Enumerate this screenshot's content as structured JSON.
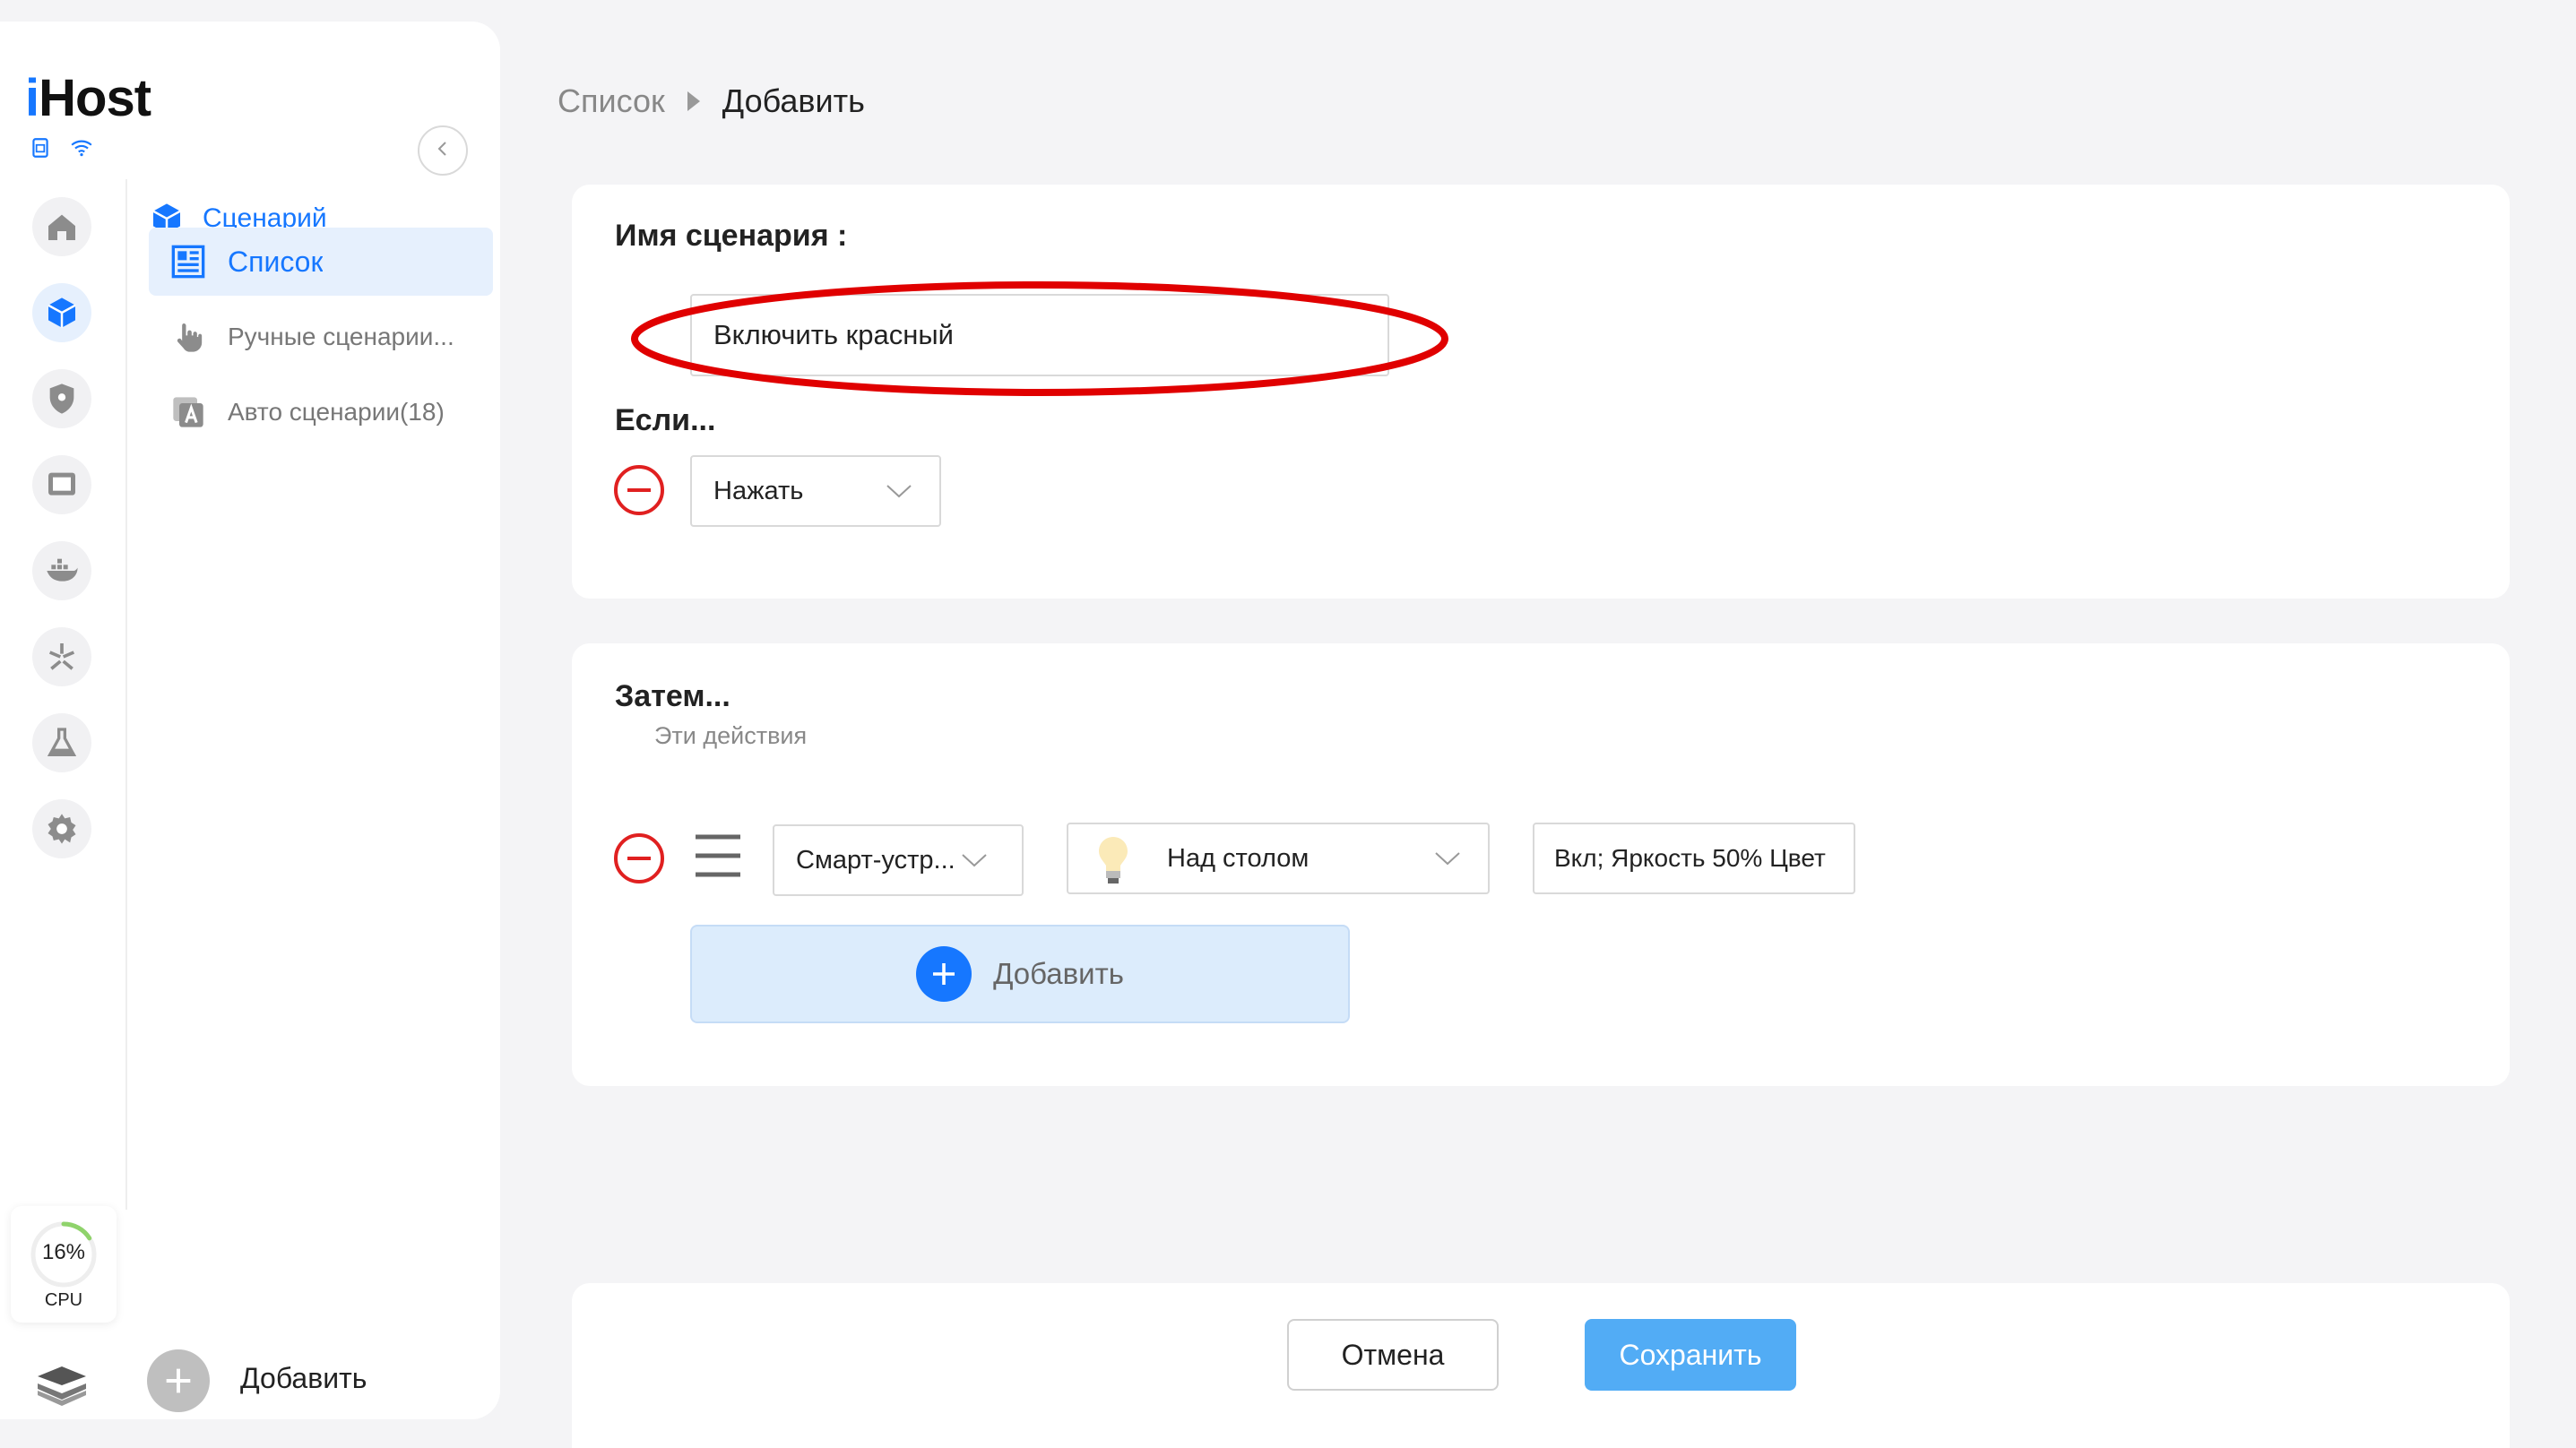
{
  "app": {
    "logo": "iHost"
  },
  "sidebar": {
    "section": {
      "label": "Сценарий",
      "icon": "cube-icon"
    },
    "items": [
      {
        "label": "Список",
        "icon": "grid-list-icon",
        "active": true
      },
      {
        "label": "Ручные сценарии...",
        "icon": "hand-pointer-icon"
      },
      {
        "label": "Авто сценарии(18)",
        "icon": "auto-icon"
      }
    ],
    "rail": [
      "home-icon",
      "cube-icon",
      "shield-icon",
      "monitor-icon",
      "docker-icon",
      "matter-icon",
      "flask-icon",
      "gear-icon"
    ],
    "cpu": {
      "value": 16,
      "percent_text": "16%",
      "label": "CPU"
    },
    "add_label": "Добавить"
  },
  "breadcrumb": {
    "items": [
      "Список",
      "Добавить"
    ]
  },
  "form": {
    "name_label": "Имя сценария :",
    "name_value": "Включить красный",
    "if_label": "Если...",
    "condition": {
      "value": "Нажать"
    },
    "then_label": "Затем...",
    "then_note": "Эти действия",
    "action": {
      "type": "Смарт-устр...",
      "device": "Над столом",
      "value": "Вкл; Яркость 50% Цвет"
    },
    "add_action_label": "Добавить"
  },
  "footer": {
    "cancel": "Отмена",
    "save": "Сохранить"
  },
  "colors": {
    "accent": "#1677ff",
    "remove": "#e02020",
    "highlight": "#e00000",
    "save": "#52acf5",
    "cpu_gauge": "#8fd36b"
  }
}
